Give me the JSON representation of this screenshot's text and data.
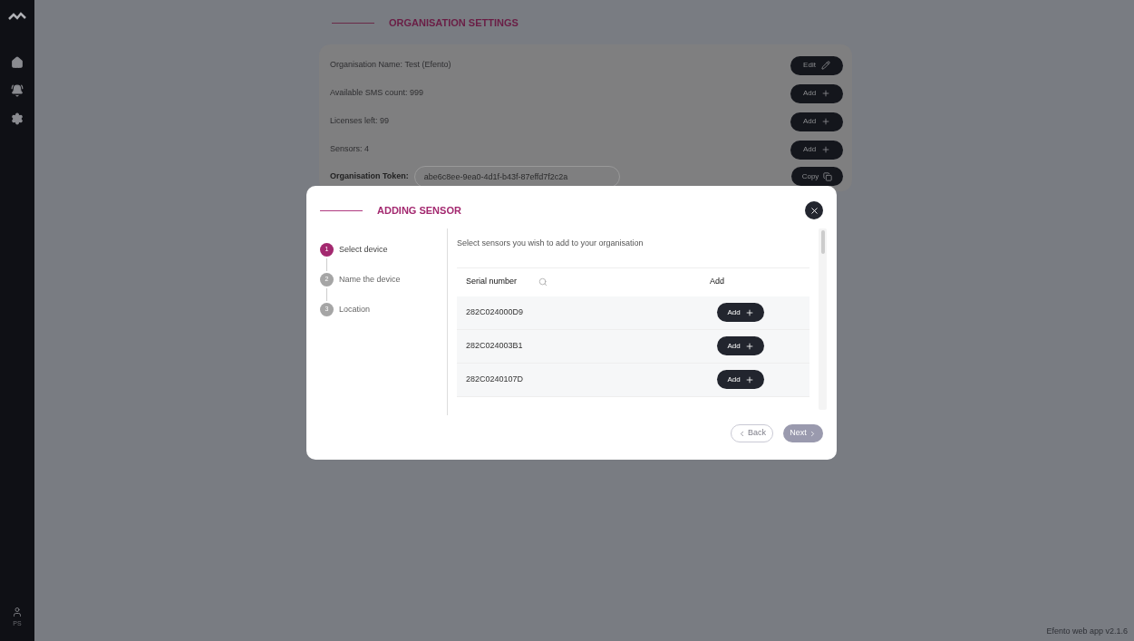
{
  "sidebar": {
    "items": [
      {
        "kind": "home"
      },
      {
        "kind": "alarm"
      },
      {
        "kind": "settings"
      }
    ],
    "user": {
      "initials": "PS"
    }
  },
  "settings": {
    "title": "ORGANISATION SETTINGS",
    "rows": [
      {
        "label": "Organisation Name: Test (Efento)",
        "action": {
          "label": "Edit",
          "kind": "edit"
        }
      },
      {
        "label": "Available SMS count: 999",
        "action": {
          "label": "Add",
          "kind": "add"
        }
      },
      {
        "label": "Licenses left: 99",
        "action": {
          "label": "Add",
          "kind": "add"
        }
      },
      {
        "label": "Sensors: 4",
        "action": {
          "label": "Add",
          "kind": "add"
        }
      }
    ],
    "token": {
      "label": "Organisation Token:",
      "value": "abe6c8ee-9ea0-4d1f-b43f-87effd7f2c2a",
      "action": {
        "label": "Copy",
        "kind": "copy"
      }
    }
  },
  "dialog": {
    "title": "ADDING SENSOR",
    "steps": [
      {
        "number": "1",
        "label": "Select device",
        "selected": true
      },
      {
        "number": "2",
        "label": "Name the device",
        "selected": false
      },
      {
        "number": "3",
        "label": "Location",
        "selected": false
      }
    ],
    "instruction": "Select sensors you wish to add to your organisation",
    "table": {
      "columns": [
        "Serial number",
        "Add"
      ],
      "rows": [
        {
          "serial": "282C024000D9",
          "action": "Add"
        },
        {
          "serial": "282C024003B1",
          "action": "Add"
        },
        {
          "serial": "282C0240107D",
          "action": "Add"
        }
      ]
    },
    "back": {
      "label": "Back",
      "disabled": true
    },
    "next": {
      "label": "Next",
      "disabled": true
    }
  },
  "footer": "Efento web app v2.1.6"
}
